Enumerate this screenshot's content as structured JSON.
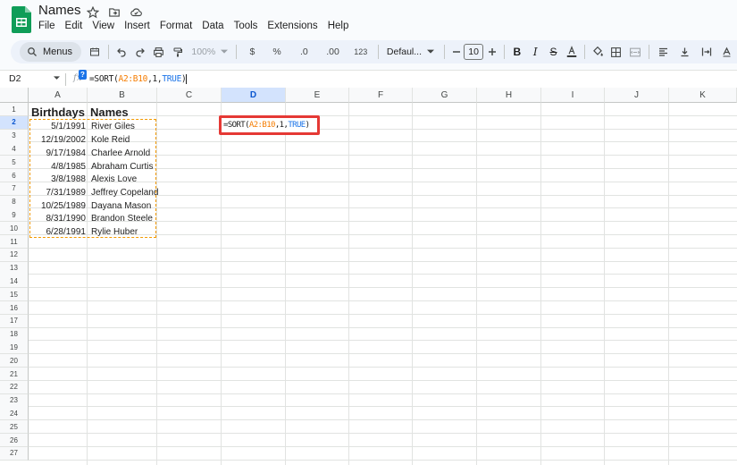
{
  "app": {
    "doc_title": "Names",
    "menu": [
      "File",
      "Edit",
      "View",
      "Insert",
      "Format",
      "Data",
      "Tools",
      "Extensions",
      "Help"
    ]
  },
  "toolbar": {
    "search_label": "Menus",
    "zoom": "100%",
    "currency": "$",
    "percent": "%",
    "dec_decrease": ".0",
    "dec_increase": ".00",
    "number_format": "123",
    "font_name": "Defaul...",
    "font_size": "10",
    "bold": "B",
    "italic": "I",
    "strike": "S"
  },
  "formula_bar": {
    "cell_ref": "D2",
    "fx": "fx",
    "help_badge": "?",
    "formula_prefix": "=SORT(",
    "formula_range": "A2:B10",
    "formula_sep1": ",",
    "formula_arg": "1",
    "formula_sep2": ",",
    "formula_bool": "TRUE",
    "formula_close": ")"
  },
  "grid": {
    "columns": [
      "A",
      "B",
      "C",
      "D",
      "E",
      "F",
      "G",
      "H",
      "I",
      "J",
      "K"
    ],
    "active_column": "D",
    "active_row": 2,
    "row_count": 27,
    "header_row": {
      "A": "Birthdays",
      "B": "Names"
    },
    "rows": [
      {
        "date": "5/1/1991",
        "name": "River Giles"
      },
      {
        "date": "12/19/2002",
        "name": "Kole Reid"
      },
      {
        "date": "9/17/1984",
        "name": "Charlee Arnold"
      },
      {
        "date": "4/8/1985",
        "name": "Abraham Curtis"
      },
      {
        "date": "3/8/1988",
        "name": "Alexis Love"
      },
      {
        "date": "7/31/1989",
        "name": "Jeffrey Copeland"
      },
      {
        "date": "10/25/1989",
        "name": "Dayana Mason"
      },
      {
        "date": "8/31/1990",
        "name": "Brandon Steele"
      },
      {
        "date": "6/28/1991",
        "name": "Rylie Huber"
      }
    ]
  },
  "colors": {
    "active_border": "#e53935",
    "copy_border": "#f29900",
    "selection_header": "#d3e3fd",
    "range_text": "#f57c00",
    "bool_text": "#1a73e8"
  }
}
